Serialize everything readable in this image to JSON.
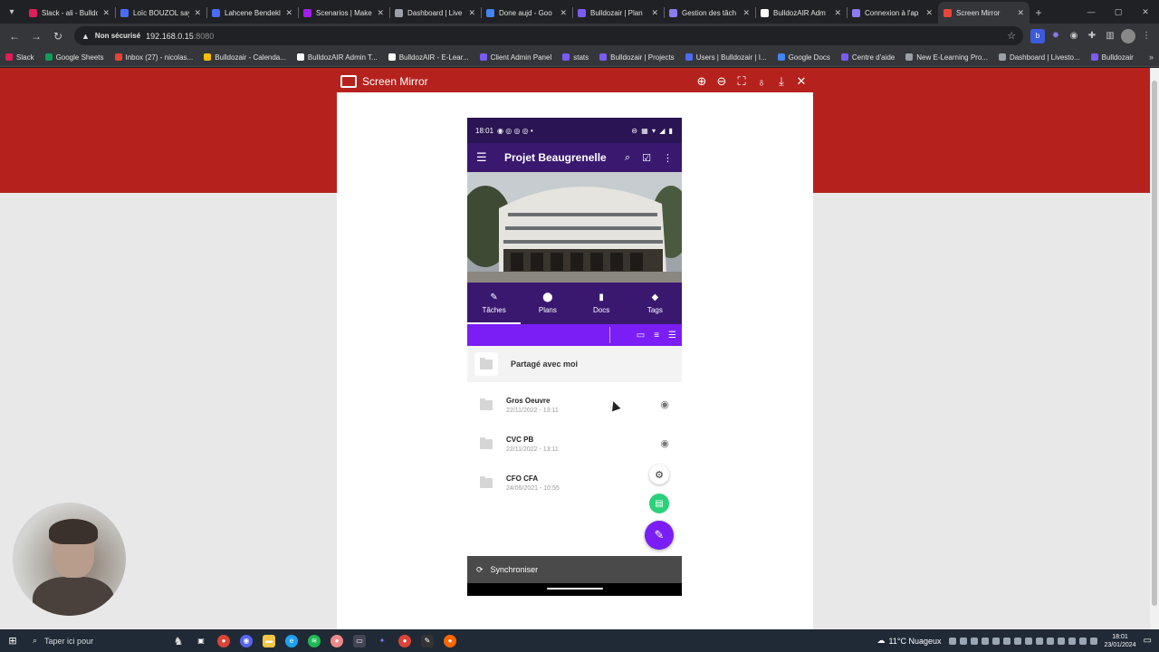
{
  "browser": {
    "tabs": [
      {
        "title": "Slack - ali - Bulldozair",
        "color": "#e01e5a"
      },
      {
        "title": "Loïc BOUZOL says",
        "color": "#4a6cf7"
      },
      {
        "title": "Lahcene Bendekl",
        "color": "#4a6cf7"
      },
      {
        "title": "Scenarios | Make",
        "color": "#a020f0"
      },
      {
        "title": "Dashboard | Live",
        "color": "#9aa0a6"
      },
      {
        "title": "Done aujd - Goo",
        "color": "#4285f4"
      },
      {
        "title": "Bulldozair | Plan",
        "color": "#7a5cf5"
      },
      {
        "title": "Gestion des tâch",
        "color": "#8a7bf0"
      },
      {
        "title": "BulldozAIR Adm",
        "color": "#ffffff"
      },
      {
        "title": "Connexion à l'ap",
        "color": "#8a7bf0"
      },
      {
        "title": "Screen Mirror",
        "color": "#e8453c",
        "active": true
      }
    ],
    "omnibox": {
      "warning": "Non sécurisé",
      "host": "192.168.0.15",
      "port": ":8080"
    },
    "bookmarks": [
      {
        "label": "Slack",
        "color": "#e01e5a"
      },
      {
        "label": "Google Sheets",
        "color": "#0f9d58"
      },
      {
        "label": "Inbox (27) - nicolas...",
        "color": "#ea4335"
      },
      {
        "label": "Bulldozair - Calenda...",
        "color": "#fbbc05"
      },
      {
        "label": "BulldozAIR Admin T...",
        "color": "#ffffff"
      },
      {
        "label": "BulldozAIR - E-Lear...",
        "color": "#ffffff"
      },
      {
        "label": "Client Admin Panel",
        "color": "#7a5cf5"
      },
      {
        "label": "stats",
        "color": "#7a5cf5"
      },
      {
        "label": "Bulldozair | Projects",
        "color": "#7a5cf5"
      },
      {
        "label": "Users | Bulldozair | I...",
        "color": "#4a6cf7"
      },
      {
        "label": "Google Docs",
        "color": "#4285f4"
      },
      {
        "label": "Centre d'aide",
        "color": "#7a5cf5"
      },
      {
        "label": "New E-Learning Pro...",
        "color": "#9aa0a6"
      },
      {
        "label": "Dashboard | Livesto...",
        "color": "#9aa0a6"
      },
      {
        "label": "Bulldozair",
        "color": "#7a5cf5"
      }
    ]
  },
  "mirror": {
    "title": "Screen Mirror"
  },
  "phone": {
    "time": "18:01",
    "project_title": "Projet Beaugrenelle",
    "tabs": [
      {
        "label": "Tâches",
        "icon": "✎",
        "active": true
      },
      {
        "label": "Plans",
        "icon": "⬤"
      },
      {
        "label": "Docs",
        "icon": "▮"
      },
      {
        "label": "Tags",
        "icon": "◆"
      }
    ],
    "shared_label": "Partagé avec moi",
    "folders": [
      {
        "name": "Gros Oeuvre",
        "date": "22/11/2022 - 13:11",
        "has_eye": true
      },
      {
        "name": "CVC PB",
        "date": "22/11/2022 - 13:11",
        "has_eye": true
      },
      {
        "name": "CFO CFA",
        "date": "24/05/2021 - 10:55",
        "has_eye": false
      }
    ],
    "sync_label": "Synchroniser"
  },
  "taskbar": {
    "search_placeholder": "Taper ici pour",
    "weather": "11°C  Nuageux",
    "time": "18:01",
    "date": "23/01/2024"
  },
  "colors": {
    "red_band": "#b5221d",
    "app_purple": "#3a1870",
    "accent_purple": "#7a1ef5",
    "fab_green": "#2bd07a"
  }
}
